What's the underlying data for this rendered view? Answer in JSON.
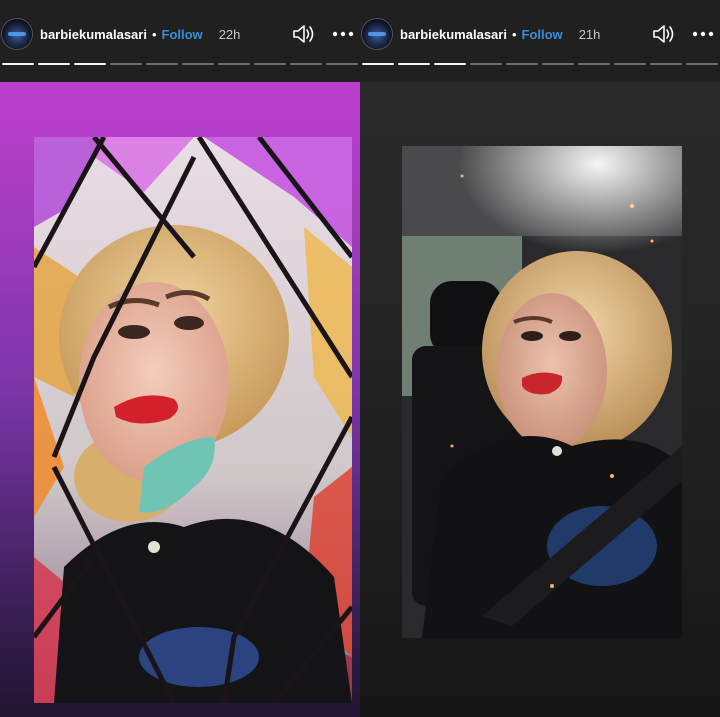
{
  "stories": [
    {
      "username": "barbiekumalasari",
      "separator": "•",
      "follow_label": "Follow",
      "time": "22h",
      "progress": {
        "segments": 10,
        "completed": 3
      }
    },
    {
      "username": "barbiekumalasari",
      "separator": "•",
      "follow_label": "Follow",
      "time": "21h",
      "progress": {
        "segments": 10,
        "completed": 3
      }
    }
  ],
  "icons": {
    "sound": "speaker-icon",
    "more": "more-options-icon"
  },
  "colors": {
    "follow": "#3a8ed8",
    "topbar": "#202020",
    "left_background": "#c23fd0"
  }
}
